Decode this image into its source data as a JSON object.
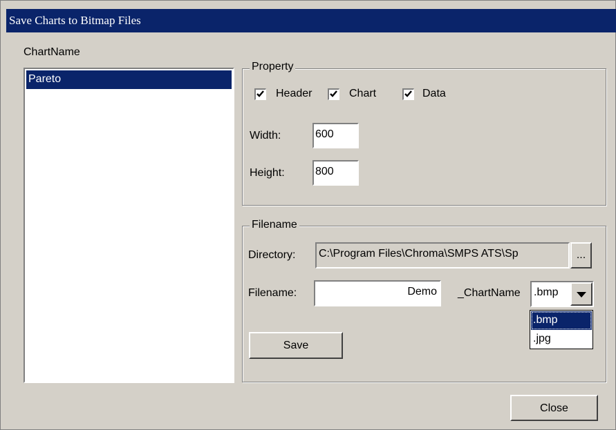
{
  "window": {
    "title": "Save Charts to Bitmap Files"
  },
  "chart_list": {
    "label": "ChartName",
    "items": [
      "Pareto"
    ],
    "selected": "Pareto"
  },
  "property": {
    "legend": "Property",
    "checkboxes": [
      {
        "label": "Header",
        "checked": true
      },
      {
        "label": "Chart",
        "checked": true
      },
      {
        "label": "Data",
        "checked": true
      }
    ],
    "width_label": "Width:",
    "width_value": "600",
    "height_label": "Height:",
    "height_value": "800"
  },
  "filename_group": {
    "legend": "Filename",
    "directory_label": "Directory:",
    "directory_value": "C:\\Program Files\\Chroma\\SMPS ATS\\Sp",
    "browse_label": "...",
    "filename_label": "Filename:",
    "filename_value": "Demo",
    "suffix_label": "_ChartName",
    "extension_selected": ".bmp",
    "extension_options": [
      ".bmp",
      ".jpg"
    ],
    "save_label": "Save"
  },
  "footer": {
    "close_label": "Close"
  }
}
